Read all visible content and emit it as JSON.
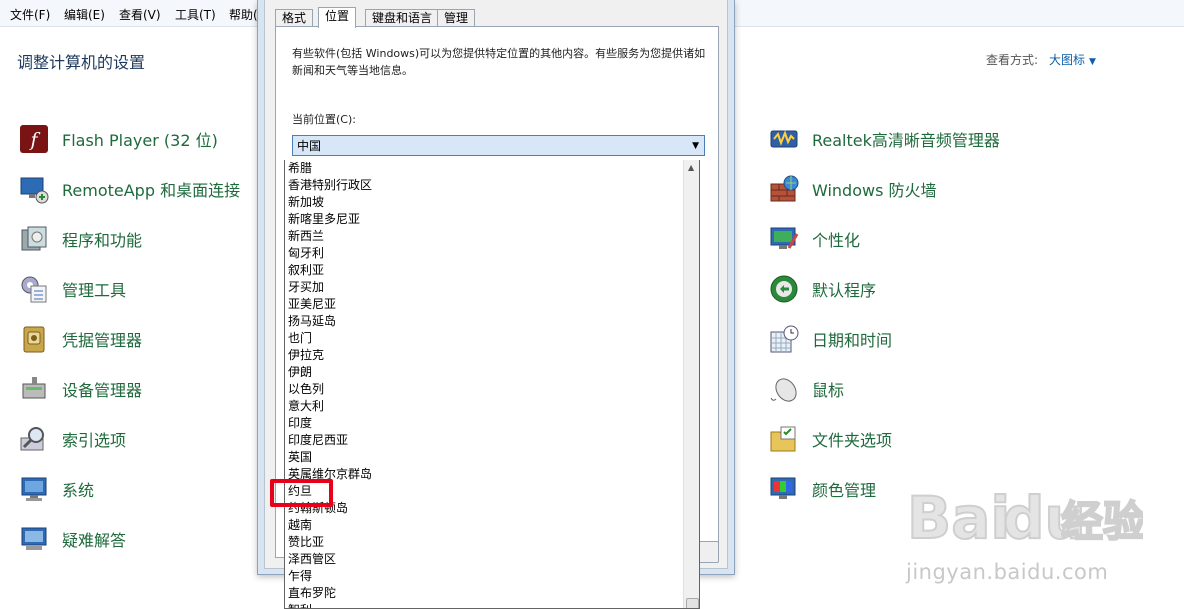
{
  "menubar": {
    "items": [
      {
        "label": "文件(F)"
      },
      {
        "label": "编辑(E)"
      },
      {
        "label": "查看(V)"
      },
      {
        "label": "工具(T)"
      },
      {
        "label": "帮助("
      }
    ]
  },
  "control_panel": {
    "title": "调整计算机的设置",
    "view_by_label": "查看方式:",
    "view_by_value": "大图标",
    "left_items": [
      {
        "label": "Flash Player (32 位)",
        "icon": "flash-player-icon"
      },
      {
        "label": "RemoteApp 和桌面连接",
        "icon": "remoteapp-icon"
      },
      {
        "label": "程序和功能",
        "icon": "programs-features-icon"
      },
      {
        "label": "管理工具",
        "icon": "admin-tools-icon"
      },
      {
        "label": "凭据管理器",
        "icon": "credential-manager-icon"
      },
      {
        "label": "设备管理器",
        "icon": "device-manager-icon"
      },
      {
        "label": "索引选项",
        "icon": "indexing-options-icon"
      },
      {
        "label": "系统",
        "icon": "system-icon"
      },
      {
        "label": "疑难解答",
        "icon": "troubleshooting-icon"
      }
    ],
    "right_items": [
      {
        "label": "Realtek高清晰音频管理器",
        "icon": "realtek-audio-icon"
      },
      {
        "label": "Windows 防火墙",
        "icon": "firewall-icon"
      },
      {
        "label": "个性化",
        "icon": "personalization-icon"
      },
      {
        "label": "默认程序",
        "icon": "default-programs-icon"
      },
      {
        "label": "日期和时间",
        "icon": "date-time-icon"
      },
      {
        "label": "鼠标",
        "icon": "mouse-icon"
      },
      {
        "label": "文件夹选项",
        "icon": "folder-options-icon"
      },
      {
        "label": "颜色管理",
        "icon": "color-management-icon"
      }
    ]
  },
  "dialog": {
    "tabs": [
      {
        "label": "格式",
        "active": false
      },
      {
        "label": "位置",
        "active": true
      },
      {
        "label": "键盘和语言",
        "active": false
      },
      {
        "label": "管理",
        "active": false
      }
    ],
    "description": "有些软件(包括 Windows)可以为您提供特定位置的其他内容。有些服务为您提供诸如新闻和天气等当地信息。",
    "current_location_label": "当前位置(C):",
    "current_location_value": "中国",
    "dropdown_options": [
      "希腊",
      "香港特别行政区",
      "新加坡",
      "新喀里多尼亚",
      "新西兰",
      "匈牙利",
      "叙利亚",
      "牙买加",
      "亚美尼亚",
      "扬马延岛",
      "也门",
      "伊拉克",
      "伊朗",
      "以色列",
      "意大利",
      "印度",
      "印度尼西亚",
      "英国",
      "英属维尔京群岛",
      "约旦",
      "约翰斯顿岛",
      "越南",
      "赞比亚",
      "泽西管区",
      "乍得",
      "直布罗陀",
      "智利"
    ],
    "highlighted_option": "约旦",
    "highlight_color": "#e8001a"
  },
  "watermark": {
    "brand": "Baidu经验",
    "url": "jingyan.baidu.com"
  }
}
